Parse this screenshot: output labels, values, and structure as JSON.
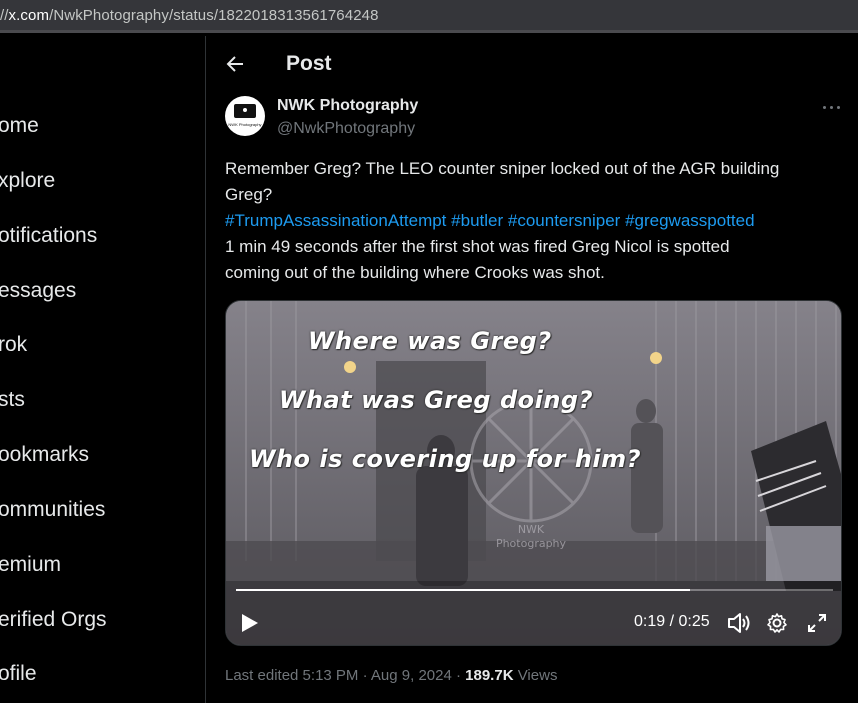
{
  "browser": {
    "url_prefix": "//",
    "url_host": "x.com",
    "url_path": "/NwkPhotography/status/1822018313561764248"
  },
  "sidebar": {
    "items": [
      {
        "label": "ome"
      },
      {
        "label": "xplore"
      },
      {
        "label": "otifications"
      },
      {
        "label": "essages"
      },
      {
        "label": "rok"
      },
      {
        "label": "sts"
      },
      {
        "label": "ookmarks"
      },
      {
        "label": "ommunities"
      },
      {
        "label": "emium"
      },
      {
        "label": "erified Orgs"
      },
      {
        "label": "ofile"
      }
    ]
  },
  "header": {
    "title": "Post",
    "back_icon": "arrow-left-icon"
  },
  "post": {
    "author_name": "NWK Photography",
    "author_handle": "@NwkPhotography",
    "avatar_text": "NWK Photography",
    "more_icon": "more-horizontal-icon",
    "text_line1": "Remember Greg? The LEO counter sniper locked out of the AGR building",
    "text_line2": "Greg?",
    "hashtags": [
      "#TrumpAssassinationAttempt",
      "#butler",
      "#countersniper",
      "#gregwasspotted"
    ],
    "text_line4": "1 min 49 seconds after the first shot was fired Greg Nicol is spotted",
    "text_line5": "coming out of the building where Crooks was shot."
  },
  "video": {
    "captions": [
      "Where was Greg?",
      "What was Greg doing?",
      "Who is covering up for him?"
    ],
    "watermark_line1": "NWK",
    "watermark_line2": "Photography",
    "current_time": "0:19",
    "separator": " / ",
    "duration": "0:25",
    "progress": 0.76,
    "icons": {
      "play": "play-icon",
      "volume": "volume-icon",
      "settings": "gear-icon",
      "fullscreen": "fullscreen-icon"
    }
  },
  "meta": {
    "edited": "Last edited 5:13 PM · Aug 9, 2024 · ",
    "views_count": "189.7K",
    "views_label": " Views"
  },
  "colors": {
    "background": "#000000",
    "text": "#e7e9ea",
    "muted": "#71767b",
    "link": "#1d9bf0",
    "border": "#2f3336"
  }
}
